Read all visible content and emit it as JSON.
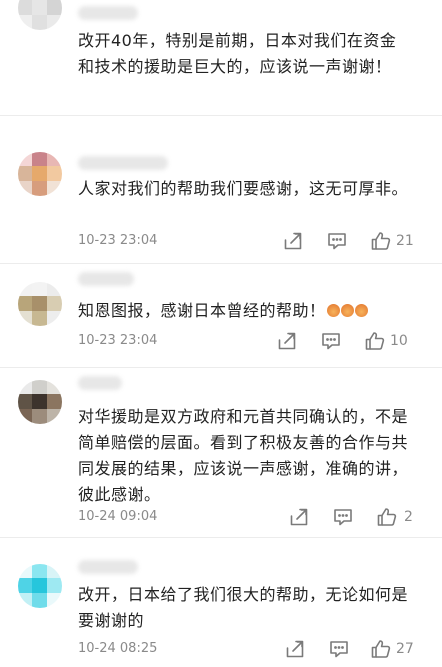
{
  "comments": [
    {
      "text": "改开40年，特别是前期，日本对我们在资金和技术的援助是巨大的，应该说一声谢谢！",
      "time": "",
      "likes": "",
      "avatar_colors": [
        "#e8e8e8",
        "#d9d9d9",
        "#f0f0f0",
        "#dcdcdc",
        "#e6e6e6",
        "#d4d4d4",
        "#efefef",
        "#e0e0e0",
        "#eaeaea"
      ]
    },
    {
      "text": "人家对我们的帮助我们要感谢，这无可厚非。",
      "time": "10-23 23:04",
      "likes": "21",
      "avatar_colors": [
        "#f4d6d6",
        "#c9838a",
        "#e8b7b4",
        "#d8b59a",
        "#e6a96b",
        "#f2c9a0",
        "#e9d4c8",
        "#d79d7d",
        "#f1e2d6"
      ]
    },
    {
      "text": "知恩图报，感谢日本曾经的帮助！",
      "time": "10-23 23:04",
      "likes": "10",
      "avatar_colors": [
        "#f2f2f2",
        "#f3f3f3",
        "#ececec",
        "#b8a57a",
        "#a8906a",
        "#d8cdb2",
        "#e4e0d2",
        "#c7b892",
        "#ededed"
      ],
      "emoji_count": 3
    },
    {
      "text": "对华援助是双方政府和元首共同确认的，不是简单赔偿的层面。看到了积极友善的合作与共同发展的结果，应该说一声感谢，准确的讲，彼此感谢。",
      "time": "10-24 09:04",
      "likes": "2",
      "avatar_colors": [
        "#eaeaea",
        "#d0cfcb",
        "#e4e2dd",
        "#5f5346",
        "#3d332c",
        "#8b7560",
        "#7a6554",
        "#9c8c7c",
        "#bdb4a8"
      ]
    },
    {
      "text": "改开，日本给了我们很大的帮助，无论如何是要谢谢的",
      "time": "10-24 08:25",
      "likes": "27",
      "avatar_colors": [
        "#e9f9fb",
        "#8be6f0",
        "#d8f4f7",
        "#4fd3e6",
        "#26c6dc",
        "#9ee9f2",
        "#c2f0f5",
        "#6fdcea",
        "#eaf9fb"
      ]
    }
  ]
}
